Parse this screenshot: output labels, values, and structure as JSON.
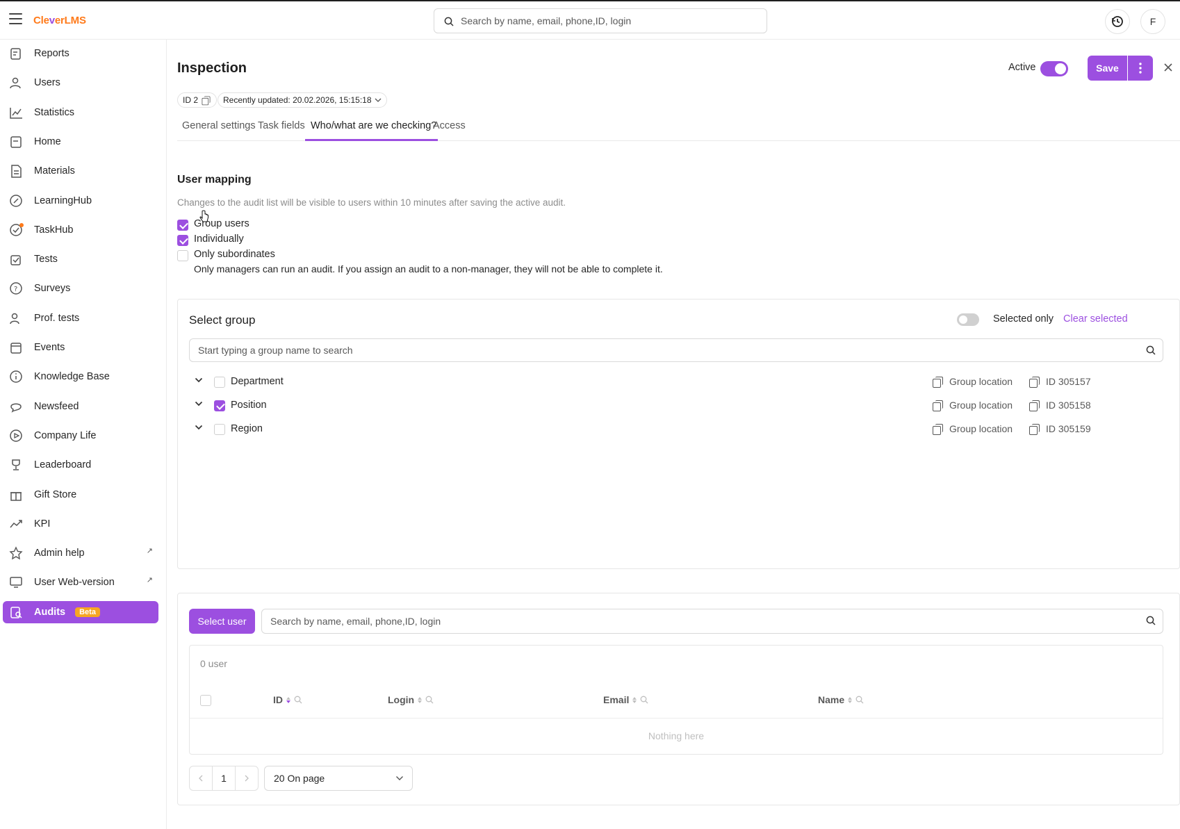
{
  "header": {
    "logo_prefix": "Cle",
    "logo_mid": "v",
    "logo_suffix": "erLMS",
    "search_placeholder": "Search by name, email, phone,ID, login",
    "avatar_letter": "F"
  },
  "sidebar": {
    "items": [
      {
        "label": "Reports",
        "icon": "reports-icon"
      },
      {
        "label": "Users",
        "icon": "users-icon"
      },
      {
        "label": "Statistics",
        "icon": "statistics-icon"
      },
      {
        "label": "Home",
        "icon": "home-icon"
      },
      {
        "label": "Materials",
        "icon": "materials-icon"
      },
      {
        "label": "LearningHub",
        "icon": "learninghub-icon"
      },
      {
        "label": "TaskHub",
        "icon": "taskhub-icon"
      },
      {
        "label": "Tests",
        "icon": "tests-icon"
      },
      {
        "label": "Surveys",
        "icon": "surveys-icon"
      },
      {
        "label": "Prof. tests",
        "icon": "prof-tests-icon"
      },
      {
        "label": "Events",
        "icon": "events-icon"
      },
      {
        "label": "Knowledge Base",
        "icon": "knowledge-base-icon"
      },
      {
        "label": "Newsfeed",
        "icon": "newsfeed-icon"
      },
      {
        "label": "Company Life",
        "icon": "company-life-icon"
      },
      {
        "label": "Leaderboard",
        "icon": "leaderboard-icon"
      },
      {
        "label": "Gift Store",
        "icon": "gift-store-icon"
      },
      {
        "label": "KPI",
        "icon": "kpi-icon"
      },
      {
        "label": "Admin help",
        "icon": "admin-help-icon",
        "external": true
      },
      {
        "label": "User Web-version",
        "icon": "web-version-icon",
        "external": true
      },
      {
        "label": "Audits",
        "icon": "audits-icon",
        "badge": "Beta",
        "active": true
      }
    ]
  },
  "page": {
    "title": "Inspection",
    "id_label": "ID 2",
    "updated_label": "Recently updated: 20.02.2026, 15:15:18",
    "active_label": "Active",
    "active_on": true,
    "save_label": "Save"
  },
  "tabs": [
    {
      "label": "General settings"
    },
    {
      "label": "Task fields"
    },
    {
      "label": "Who/what are we checking?",
      "active": true
    },
    {
      "label": "Access"
    }
  ],
  "mapping": {
    "title": "User mapping",
    "hint": "Changes to the audit list will be visible to users within 10 minutes after saving the active audit.",
    "options": [
      {
        "label": "Group users",
        "checked": true
      },
      {
        "label": "Individually",
        "checked": true
      },
      {
        "label": "Only subordinates",
        "checked": false
      }
    ],
    "note": "Only managers can run an audit. If you assign an audit to a non-manager, they will not be able to complete it."
  },
  "groups": {
    "title": "Select group",
    "selected_only_label": "Selected only",
    "selected_only_on": false,
    "clear_label": "Clear selected",
    "search_placeholder": "Start typing a group name to search",
    "rows": [
      {
        "name": "Department",
        "checked": false,
        "location": "Group location",
        "id": "ID 305157"
      },
      {
        "name": "Position",
        "checked": true,
        "location": "Group location",
        "id": "ID 305158"
      },
      {
        "name": "Region",
        "checked": false,
        "location": "Group location",
        "id": "ID 305159"
      }
    ]
  },
  "users": {
    "select_label": "Select user",
    "search_placeholder": "Search by name, email, phone,ID, login",
    "count_label": "0 user",
    "columns": [
      "ID",
      "Login",
      "Email",
      "Name"
    ],
    "empty_label": "Nothing here",
    "page": "1",
    "per_page": "20 On page"
  },
  "colors": {
    "accent": "#9c4fe0",
    "beta": "#f6a623",
    "logo_orange": "#ff7a1a"
  }
}
